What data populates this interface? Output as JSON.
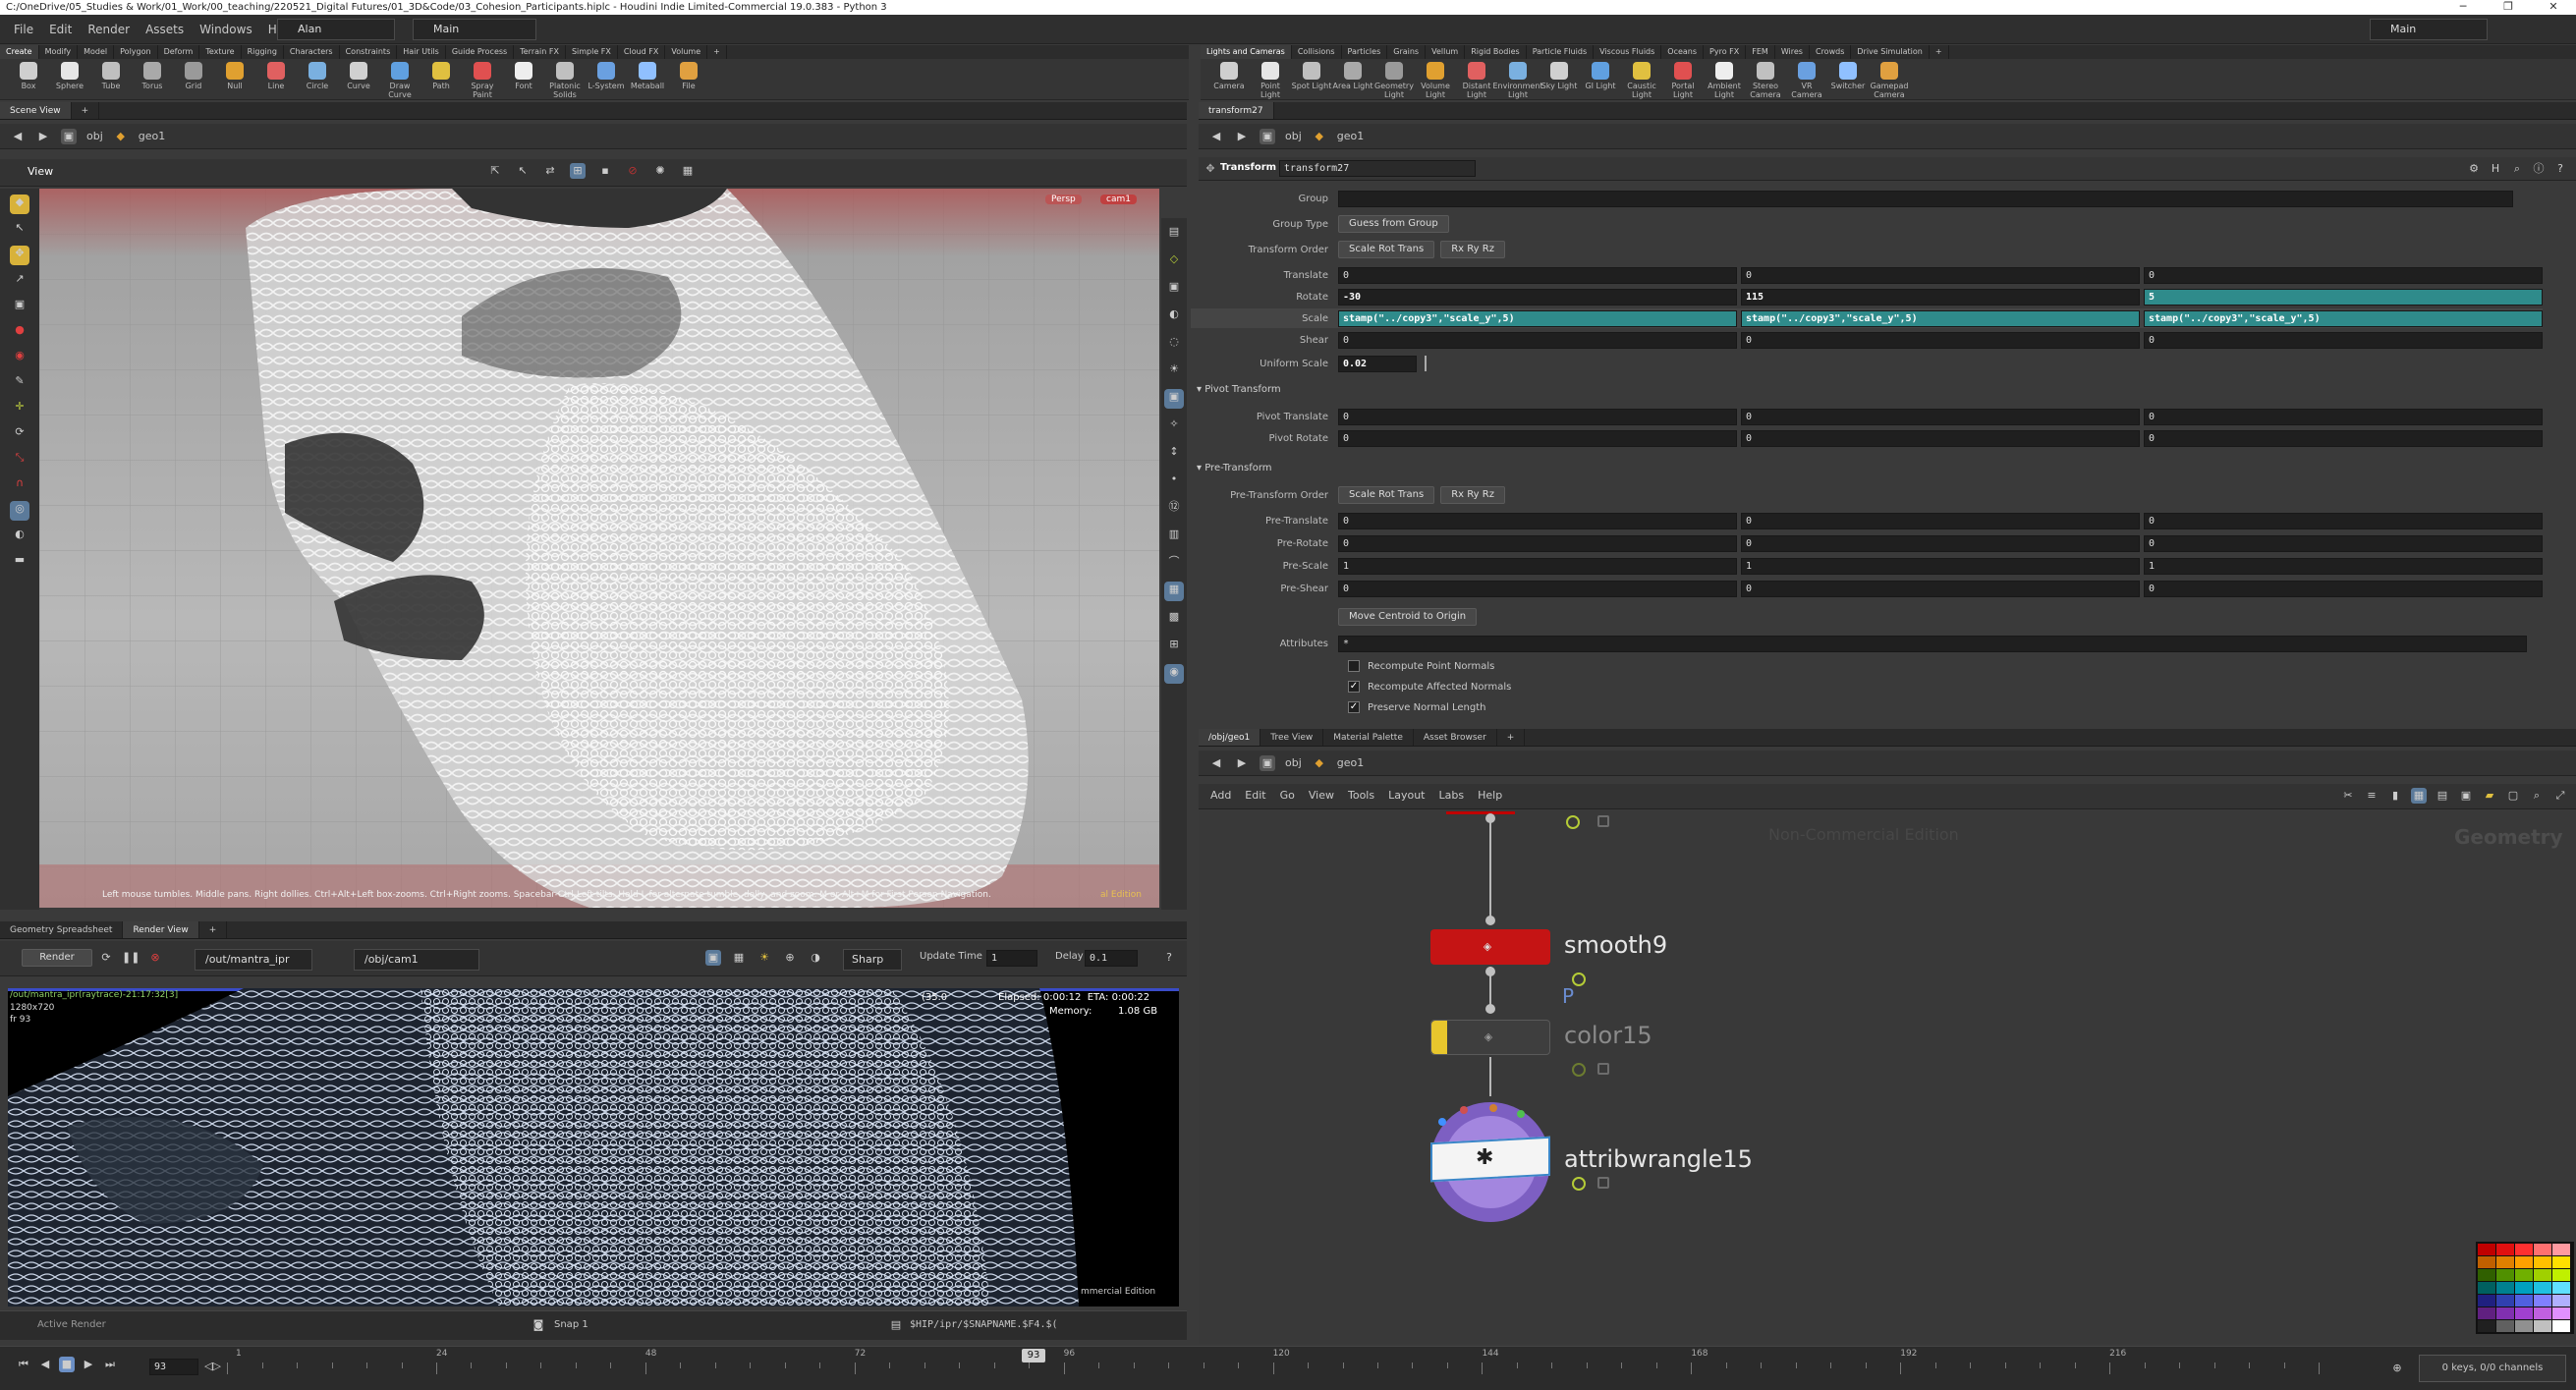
{
  "titlebar": {
    "text": "C:/OneDrive/05_Studies & Work/01_Work/00_teaching/220521_Digital Futures/01_3D&Code/03_Cohesion_Participants.hiplc - Houdini Indie Limited-Commercial 19.0.383 - Python 3"
  },
  "menu": {
    "items": [
      "File",
      "Edit",
      "Render",
      "Assets",
      "Windows",
      "Help"
    ],
    "desktop": "Alan",
    "workspace": "Main",
    "right_workspace": "Main"
  },
  "shelf_left": {
    "tabs": [
      "Create",
      "Modify",
      "Model",
      "Polygon",
      "Deform",
      "Texture",
      "Rigging",
      "Characters",
      "Constraints",
      "Hair Utils",
      "Guide Process",
      "Terrain FX",
      "Simple FX",
      "Cloud FX",
      "Volume"
    ],
    "tools": [
      {
        "label": "Box",
        "icon": "box-icon"
      },
      {
        "label": "Sphere",
        "icon": "sphere-icon"
      },
      {
        "label": "Tube",
        "icon": "tube-icon"
      },
      {
        "label": "Torus",
        "icon": "torus-icon"
      },
      {
        "label": "Grid",
        "icon": "grid-icon"
      },
      {
        "label": "Null",
        "icon": "null-icon"
      },
      {
        "label": "Line",
        "icon": "line-icon"
      },
      {
        "label": "Circle",
        "icon": "circle-icon"
      },
      {
        "label": "Curve",
        "icon": "curve-icon"
      },
      {
        "label": "Draw Curve",
        "icon": "draw-curve-icon"
      },
      {
        "label": "Path",
        "icon": "path-icon"
      },
      {
        "label": "Spray Paint",
        "icon": "spray-paint-icon"
      },
      {
        "label": "Font",
        "icon": "font-icon"
      },
      {
        "label": "Platonic Solids",
        "icon": "platonic-icon"
      },
      {
        "label": "L-System",
        "icon": "lsystem-icon"
      },
      {
        "label": "Metaball",
        "icon": "metaball-icon"
      },
      {
        "label": "File",
        "icon": "file-icon"
      }
    ]
  },
  "shelf_right": {
    "tabs": [
      "Lights and Cameras",
      "Collisions",
      "Particles",
      "Grains",
      "Vellum",
      "Rigid Bodies",
      "Particle Fluids",
      "Viscous Fluids",
      "Oceans",
      "Pyro FX",
      "FEM",
      "Wires",
      "Crowds",
      "Drive Simulation"
    ],
    "tools": [
      {
        "label": "Camera",
        "icon": "camera-icon"
      },
      {
        "label": "Point Light",
        "icon": "point-light-icon"
      },
      {
        "label": "Spot Light",
        "icon": "spot-light-icon"
      },
      {
        "label": "Area Light",
        "icon": "area-light-icon"
      },
      {
        "label": "Geometry Light",
        "icon": "geometry-light-icon"
      },
      {
        "label": "Volume Light",
        "icon": "volume-light-icon"
      },
      {
        "label": "Distant Light",
        "icon": "distant-light-icon"
      },
      {
        "label": "Environment Light",
        "icon": "environment-light-icon"
      },
      {
        "label": "Sky Light",
        "icon": "sky-light-icon"
      },
      {
        "label": "GI Light",
        "icon": "gi-light-icon"
      },
      {
        "label": "Caustic Light",
        "icon": "caustic-light-icon"
      },
      {
        "label": "Portal Light",
        "icon": "portal-light-icon"
      },
      {
        "label": "Ambient Light",
        "icon": "ambient-light-icon"
      },
      {
        "label": "Stereo Camera",
        "icon": "stereo-camera-icon"
      },
      {
        "label": "VR Camera",
        "icon": "vr-camera-icon"
      },
      {
        "label": "Switcher",
        "icon": "switcher-icon"
      },
      {
        "label": "Gamepad Camera",
        "icon": "gamepad-camera-icon"
      }
    ]
  },
  "sceneview": {
    "tab": "Scene View",
    "path_root": "obj",
    "path_node": "geo1",
    "view_label": "View",
    "persp": "Persp",
    "cam": "cam1",
    "hint": "Left mouse tumbles. Middle pans. Right dollies. Ctrl+Alt+Left box-zooms. Ctrl+Right zooms. Spacebar-Ctrl-Left tilts. Hold L for alternate tumble, dolly, and zoom.     M or Alt+M for First Person Navigation.",
    "watermark": "al Edition"
  },
  "params": {
    "tab": "transform27",
    "path_root": "obj",
    "path_node": "geo1",
    "node_type": "Transform",
    "node_name": "transform27",
    "group_label": "Group",
    "group_type_label": "Group Type",
    "group_type": "Guess from Group",
    "order_label": "Transform Order",
    "order_a": "Scale Rot Trans",
    "order_b": "Rx Ry Rz",
    "translate_label": "Translate",
    "translate": [
      "0",
      "0",
      "0"
    ],
    "rotate_label": "Rotate",
    "rotate": [
      "-30",
      "115",
      "5"
    ],
    "scale_label": "Scale",
    "scale": [
      "stamp(\"../copy3\",\"scale_y\",5)",
      "stamp(\"../copy3\",\"scale_y\",5)",
      "stamp(\"../copy3\",\"scale_y\",5)"
    ],
    "shear_label": "Shear",
    "shear": [
      "0",
      "0",
      "0"
    ],
    "uniform_label": "Uniform Scale",
    "uniform": "0.02",
    "pivot_section": "Pivot Transform",
    "pivot_translate_label": "Pivot Translate",
    "pivot_translate": [
      "0",
      "0",
      "0"
    ],
    "pivot_rotate_label": "Pivot Rotate",
    "pivot_rotate": [
      "0",
      "0",
      "0"
    ],
    "pre_section": "Pre-Transform",
    "pre_order_label": "Pre-Transform Order",
    "pre_order_a": "Scale Rot Trans",
    "pre_order_b": "Rx Ry Rz",
    "pre_translate_label": "Pre-Translate",
    "pre_translate": [
      "0",
      "0",
      "0"
    ],
    "pre_rotate_label": "Pre-Rotate",
    "pre_rotate": [
      "0",
      "0",
      "0"
    ],
    "pre_scale_label": "Pre-Scale",
    "pre_scale": [
      "1",
      "1",
      "1"
    ],
    "pre_shear_label": "Pre-Shear",
    "pre_shear": [
      "0",
      "0",
      "0"
    ],
    "move_centroid": "Move Centroid to Origin",
    "attributes_label": "Attributes",
    "attributes": "*",
    "recompute_point": "Recompute Point Normals",
    "recompute_affected": "Recompute Affected Normals",
    "preserve": "Preserve Normal Length"
  },
  "network": {
    "tabs": [
      "/obj/geo1",
      "Tree View",
      "Material Palette",
      "Asset Browser"
    ],
    "path_root": "obj",
    "path_node": "geo1",
    "menu": [
      "Add",
      "Edit",
      "Go",
      "View",
      "Tools",
      "Layout",
      "Labs",
      "Help"
    ],
    "watermark": "Non-Commercial Edition",
    "context": "Geometry",
    "nodes": {
      "smooth": "smooth9",
      "color": "color15",
      "wrangle": "attribwrangle15",
      "wire_label": "P"
    }
  },
  "renderview": {
    "tabs": [
      "Geometry Spreadsheet",
      "Render View"
    ],
    "render_btn": "Render",
    "rop": "/out/mantra_ipr",
    "camera": "/obj/cam1",
    "sharp": "Sharp",
    "update_label": "Update Time",
    "update_val": "1",
    "delay_label": "Delay",
    "delay_val": "0.1",
    "info": "/out/mantra_ipr(raytrace)-21:17:32[3]",
    "res": "1280x720",
    "frame": "fr 93",
    "elapsed": "Elapsed: 0:00:12  ETA: 0:00:22",
    "memory_label": "Memory:",
    "memory": "1.08 GB",
    "progress": "(35.0",
    "watermark": "mmercial Edition",
    "active_render": "Active Render",
    "snap": "Snap 1",
    "snap_path": "$HIP/ipr/$SNAPNAME.$F4.$("
  },
  "timeline": {
    "frame": "93",
    "ticks": [
      "1",
      "24",
      "48",
      "72",
      "96",
      "120",
      "144",
      "168",
      "192",
      "216"
    ],
    "current": "93",
    "keys": "0 keys, 0/0 channels"
  },
  "swatches": [
    "#c00000",
    "#e01010",
    "#ff3030",
    "#ff7070",
    "#ff9aa0",
    "#c06000",
    "#e08000",
    "#ffa000",
    "#ffc000",
    "#ffe000",
    "#306000",
    "#509000",
    "#70b000",
    "#a0d000",
    "#c0f000",
    "#006060",
    "#008090",
    "#00a0c0",
    "#20c0e0",
    "#60e0ff",
    "#202080",
    "#3040b0",
    "#5060e0",
    "#8080ff",
    "#b0b0ff",
    "#602080",
    "#8030b0",
    "#a040d0",
    "#c060e0",
    "#e090ff",
    "#202020",
    "#606060",
    "#909090",
    "#c0c0c0",
    "#ffffff"
  ]
}
